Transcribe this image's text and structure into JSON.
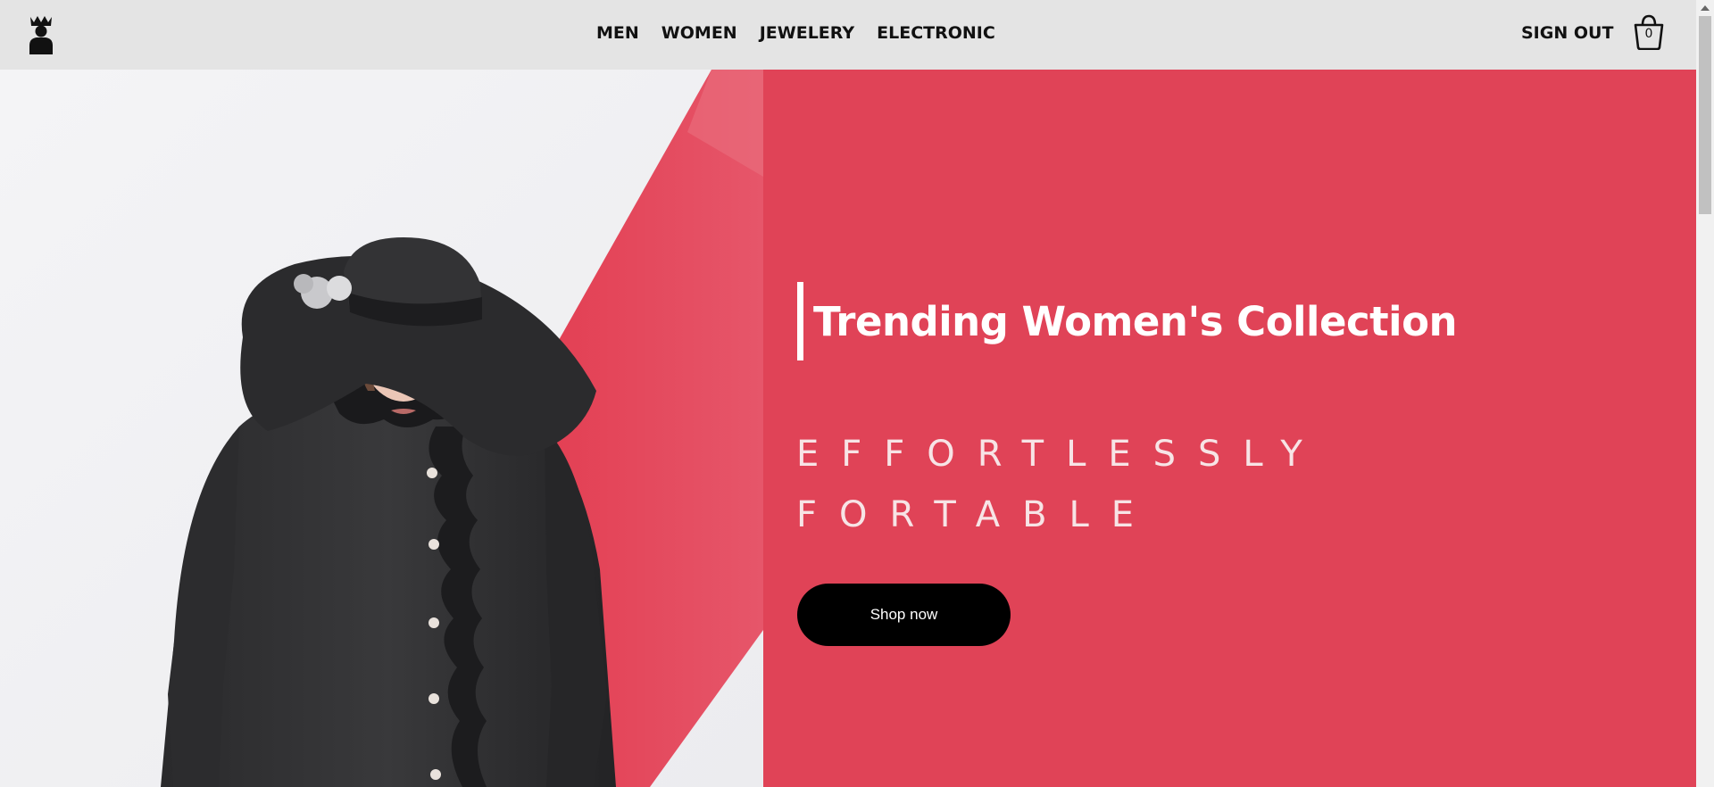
{
  "nav": {
    "logo_icon": "crowned-person-logo-icon",
    "links": [
      {
        "label": "MEN"
      },
      {
        "label": "WOMEN"
      },
      {
        "label": "JEWELERY"
      },
      {
        "label": "ELECTRONIC"
      }
    ],
    "sign_out": "SIGN OUT",
    "cart": {
      "icon": "shopping-bag-icon",
      "count": "0"
    }
  },
  "hero": {
    "image_icon": "woman-in-black-hat-and-coat-photo",
    "headline": "Trending Women's Collection",
    "tagline_lines": [
      "EFFORTLESSLY",
      "FORTABLE"
    ],
    "cta_label": "Shop now"
  },
  "colors": {
    "nav_background": "#e4e4e4",
    "accent": "#e04357",
    "cta_background": "#000000",
    "text_light": "#ffffff"
  }
}
